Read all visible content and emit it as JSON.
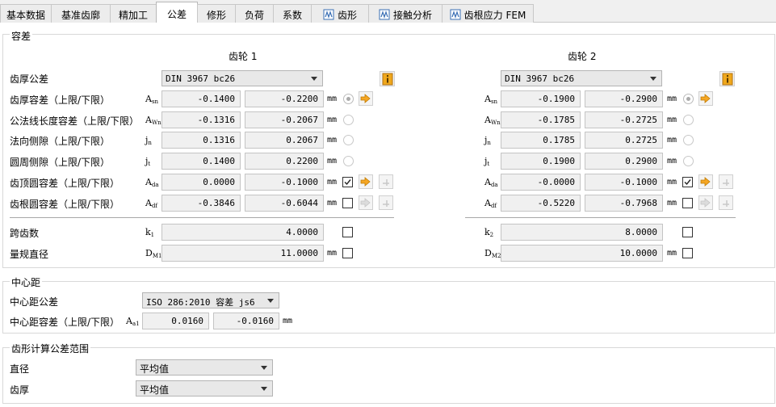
{
  "tabs": [
    {
      "label": "基本数据"
    },
    {
      "label": "基准齿廓"
    },
    {
      "label": "精加工"
    },
    {
      "label": "公差"
    },
    {
      "label": "修形"
    },
    {
      "label": "负荷"
    },
    {
      "label": "系数"
    },
    {
      "label": "齿形"
    },
    {
      "label": "接触分析"
    },
    {
      "label": "齿根应力 FEM"
    }
  ],
  "tolerances": {
    "group_title": "容差",
    "gear1_header": "齿轮 1",
    "gear2_header": "齿轮 2",
    "thickness_tol_label": "齿厚公差",
    "gear1_tol_select": "DIN 3967 bc26",
    "gear2_tol_select": "DIN 3967 bc26",
    "unit": "mm",
    "rows": [
      {
        "label": "齿厚容差（上限/下限）",
        "sym1": "A",
        "sub1": "sn",
        "sym2": "A",
        "sub2": "sn",
        "g1_upper": "-0.1400",
        "g1_lower": "-0.2200",
        "g2_upper": "-0.1900",
        "g2_lower": "-0.2900"
      },
      {
        "label": "公法线长度容差（上限/下限）",
        "sym1": "A",
        "sub1": "Wn",
        "sym2": "A",
        "sub2": "Wn",
        "g1_upper": "-0.1316",
        "g1_lower": "-0.2067",
        "g2_upper": "-0.1785",
        "g2_lower": "-0.2725"
      },
      {
        "label": "法向侧隙（上限/下限）",
        "sym1": "j",
        "sub1": "n",
        "sym2": "j",
        "sub2": "n",
        "g1_upper": "0.1316",
        "g1_lower": "0.2067",
        "g2_upper": "0.1785",
        "g2_lower": "0.2725"
      },
      {
        "label": "圆周侧隙（上限/下限）",
        "sym1": "j",
        "sub1": "t",
        "sym2": "j",
        "sub2": "t",
        "g1_upper": "0.1400",
        "g1_lower": "0.2200",
        "g2_upper": "0.1900",
        "g2_lower": "0.2900"
      },
      {
        "label": "齿顶圆容差（上限/下限）",
        "sym1": "A",
        "sub1": "da",
        "sym2": "A",
        "sub2": "da",
        "g1_upper": "0.0000",
        "g1_lower": "-0.1000",
        "g2_upper": "-0.0000",
        "g2_lower": "-0.1000"
      },
      {
        "label": "齿根圆容差（上限/下限）",
        "sym1": "A",
        "sub1": "df",
        "sym2": "A",
        "sub2": "df",
        "g1_upper": "-0.3846",
        "g1_lower": "-0.6044",
        "g2_upper": "-0.5220",
        "g2_lower": "-0.7968"
      }
    ],
    "span_label": "跨齿数",
    "span_sym1": "k",
    "span_sub1": "1",
    "span_sym2": "k",
    "span_sub2": "2",
    "span_g1": "4.0000",
    "span_g2": "8.0000",
    "ball_label": "量规直径",
    "ball_sym1": "D",
    "ball_sub1": "M1",
    "ball_sym2": "D",
    "ball_sub2": "M2",
    "ball_g1": "11.0000",
    "ball_g2": "10.0000"
  },
  "center": {
    "group_title": "中心距",
    "tol_label": "中心距公差",
    "tol_select": "ISO 286:2010 容差 js6",
    "dev_label": "中心距容差（上限/下限）",
    "dev_sym": "A",
    "dev_sub": "a1",
    "upper": "0.0160",
    "lower": "-0.0160",
    "unit": "mm"
  },
  "range": {
    "group_title": "齿形计算公差范围",
    "diameter_label": "直径",
    "diameter_select": "平均值",
    "thickness_label": "齿厚",
    "thickness_select": "平均值"
  },
  "colors": {
    "accent_arrow": "#f5a623",
    "info_icon": "#f0a81c",
    "field_bg": "#f0f0f0"
  }
}
